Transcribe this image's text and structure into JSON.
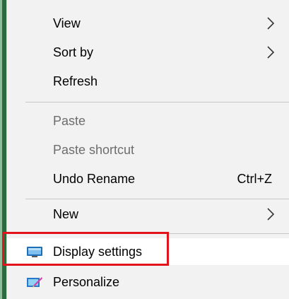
{
  "context_menu": {
    "items": [
      {
        "label": "View",
        "has_submenu": true,
        "enabled": true
      },
      {
        "label": "Sort by",
        "has_submenu": true,
        "enabled": true
      },
      {
        "label": "Refresh",
        "has_submenu": false,
        "enabled": true
      },
      {
        "label": "Paste",
        "has_submenu": false,
        "enabled": false
      },
      {
        "label": "Paste shortcut",
        "has_submenu": false,
        "enabled": false
      },
      {
        "label": "Undo Rename",
        "shortcut": "Ctrl+Z",
        "has_submenu": false,
        "enabled": true
      },
      {
        "label": "New",
        "has_submenu": true,
        "enabled": true
      },
      {
        "label": "Display settings",
        "icon": "display-monitor-icon",
        "has_submenu": false,
        "enabled": true,
        "highlighted": true
      },
      {
        "label": "Personalize",
        "icon": "personalize-icon",
        "has_submenu": false,
        "enabled": true
      }
    ]
  },
  "colors": {
    "menu_background": "#f2f2f2",
    "highlight_background": "#ffffff",
    "annotation_box": "#e0141a",
    "disabled_text": "#6d6d6d",
    "separator": "#c8c8c8"
  }
}
